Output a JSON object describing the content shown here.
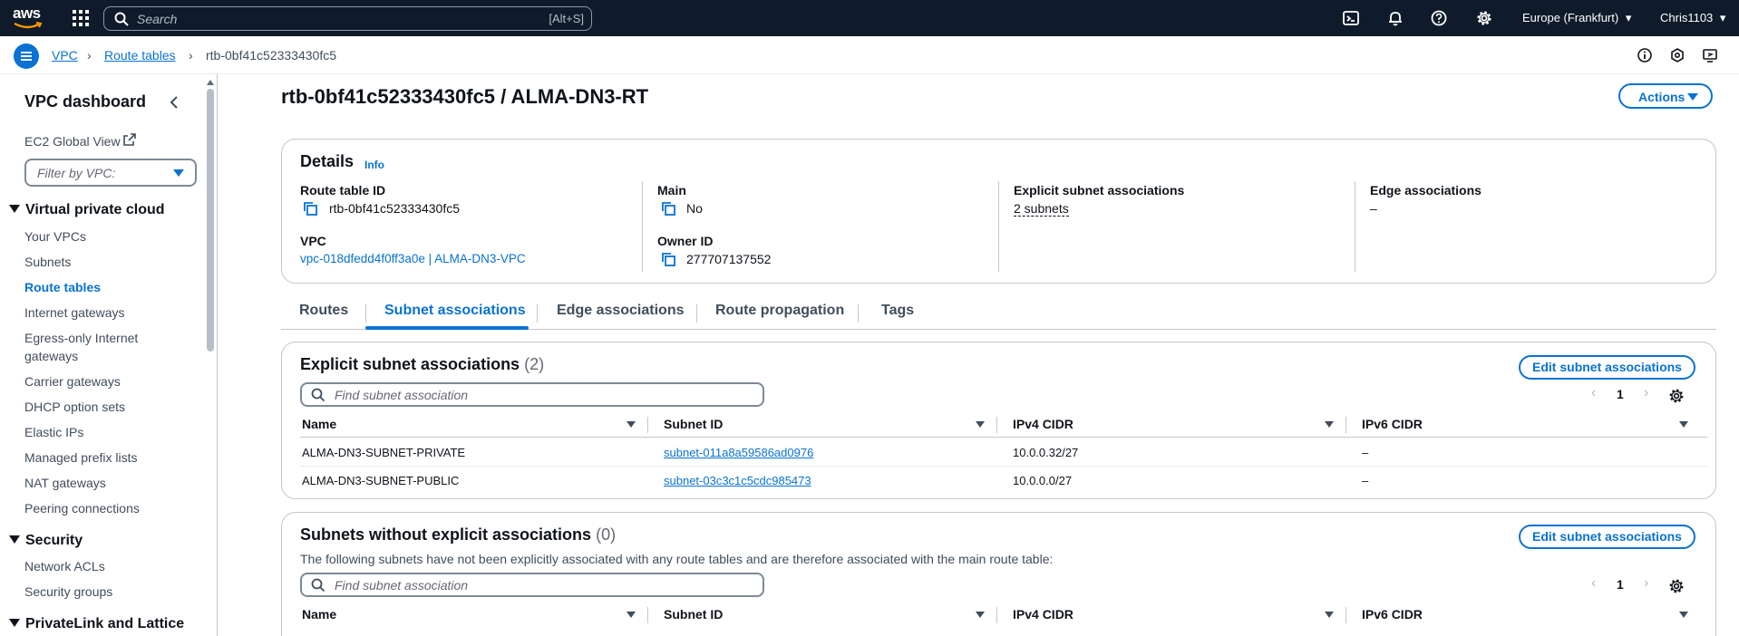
{
  "topnav": {
    "logo": "aws",
    "search_placeholder": "Search",
    "search_shortcut": "[Alt+S]",
    "region": "Europe (Frankfurt)",
    "user": "Chris1103"
  },
  "breadcrumb": {
    "items": [
      "VPC",
      "Route tables",
      "rtb-0bf41c52333430fc5"
    ]
  },
  "sidebar": {
    "title": "VPC dashboard",
    "global_view": "EC2 Global View",
    "filter_placeholder": "Filter by VPC:",
    "section_vpc": "Virtual private cloud",
    "vpc_items": [
      "Your VPCs",
      "Subnets",
      "Route tables",
      "Internet gateways",
      "Egress-only Internet",
      "gateways",
      "Carrier gateways",
      "DHCP option sets",
      "Elastic IPs",
      "Managed prefix lists",
      "NAT gateways",
      "Peering connections"
    ],
    "section_security": "Security",
    "security_items": [
      "Network ACLs",
      "Security groups"
    ],
    "section_privatelink": "PrivateLink and Lattice"
  },
  "page": {
    "title": "rtb-0bf41c52333430fc5 / ALMA-DN3-RT",
    "actions_label": "Actions"
  },
  "details": {
    "title": "Details",
    "info": "Info",
    "route_table_id_label": "Route table ID",
    "route_table_id": "rtb-0bf41c52333430fc5",
    "main_label": "Main",
    "main": "No",
    "explicit_label": "Explicit subnet associations",
    "explicit": "2 subnets",
    "edge_label": "Edge associations",
    "edge": "–",
    "vpc_label": "VPC",
    "vpc": "vpc-018dfedd4f0ff3a0e | ALMA-DN3-VPC",
    "owner_label": "Owner ID",
    "owner": "277707137552"
  },
  "tabs": [
    "Routes",
    "Subnet associations",
    "Edge associations",
    "Route propagation",
    "Tags"
  ],
  "explicit_table": {
    "title": "Explicit subnet associations",
    "count": "(2)",
    "edit_label": "Edit subnet associations",
    "search_placeholder": "Find subnet association",
    "page": "1",
    "columns": [
      "Name",
      "Subnet ID",
      "IPv4 CIDR",
      "IPv6 CIDR"
    ],
    "rows": [
      {
        "name": "ALMA-DN3-SUBNET-PRIVATE",
        "subnet_id": "subnet-011a8a59586ad0976",
        "ipv4": "10.0.0.32/27",
        "ipv6": "–"
      },
      {
        "name": "ALMA-DN3-SUBNET-PUBLIC",
        "subnet_id": "subnet-03c3c1c5cdc985473",
        "ipv4": "10.0.0.0/27",
        "ipv6": "–"
      }
    ]
  },
  "without_table": {
    "title": "Subnets without explicit associations",
    "count": "(0)",
    "edit_label": "Edit subnet associations",
    "description": "The following subnets have not been explicitly associated with any route tables and are therefore associated with the main route table:",
    "search_placeholder": "Find subnet association",
    "page": "1",
    "columns": [
      "Name",
      "Subnet ID",
      "IPv4 CIDR",
      "IPv6 CIDR"
    ]
  },
  "colors": {
    "link": "#0972d3",
    "topnav_bg": "#0f1b2a",
    "text": "#0f141a"
  }
}
